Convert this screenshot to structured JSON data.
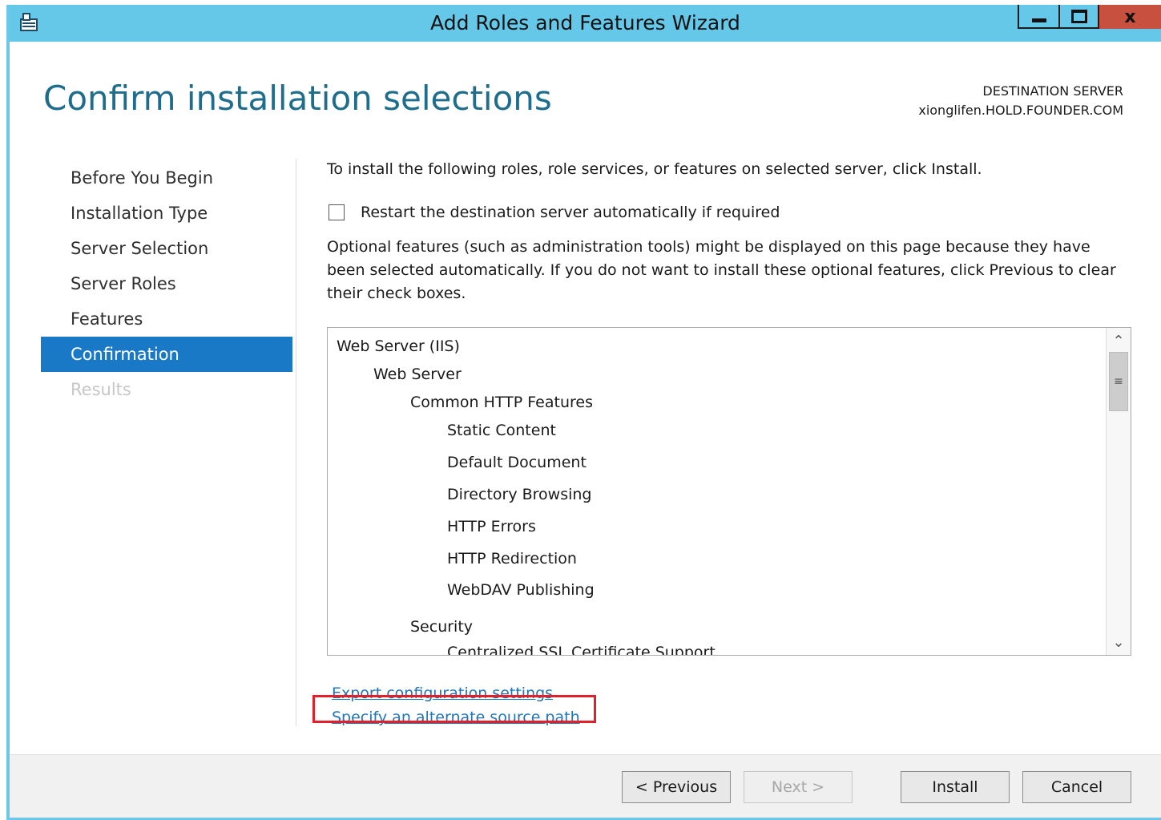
{
  "window": {
    "title": "Add Roles and Features Wizard"
  },
  "header": {
    "page_title": "Confirm installation selections",
    "destination_label": "DESTINATION SERVER",
    "destination_server": "xionglifen.HOLD.FOUNDER.COM"
  },
  "nav": {
    "items": [
      {
        "label": "Before You Begin",
        "state": "normal"
      },
      {
        "label": "Installation Type",
        "state": "normal"
      },
      {
        "label": "Server Selection",
        "state": "normal"
      },
      {
        "label": "Server Roles",
        "state": "normal"
      },
      {
        "label": "Features",
        "state": "normal"
      },
      {
        "label": "Confirmation",
        "state": "active"
      },
      {
        "label": "Results",
        "state": "disabled"
      }
    ]
  },
  "content": {
    "intro": "To install the following roles, role services, or features on selected server, click Install.",
    "restart_label": "Restart the destination server automatically if required",
    "restart_checked": false,
    "optional_note": "Optional features (such as administration tools) might be displayed on this page because they have been selected automatically. If you do not want to install these optional features, click Previous to clear their check boxes.",
    "selections": [
      {
        "label": "Web Server (IIS)",
        "level": 0
      },
      {
        "label": "Web Server",
        "level": 1
      },
      {
        "label": "Common HTTP Features",
        "level": 2
      },
      {
        "label": "Static Content",
        "level": 3
      },
      {
        "label": "Default Document",
        "level": 3
      },
      {
        "label": "Directory Browsing",
        "level": 3
      },
      {
        "label": "HTTP Errors",
        "level": 3
      },
      {
        "label": "HTTP Redirection",
        "level": 3
      },
      {
        "label": "WebDAV Publishing",
        "level": 3
      },
      {
        "label": "Security",
        "level": 2
      },
      {
        "label": "Centralized SSL Certificate Support",
        "level": 3
      }
    ],
    "export_link": "Export configuration settings",
    "alternate_link": "Specify an alternate source path"
  },
  "footer": {
    "previous": "< Previous",
    "next": "Next >",
    "install": "Install",
    "cancel": "Cancel"
  },
  "colors": {
    "titlebar": "#66c8e8",
    "accent": "#1979c6",
    "link": "#2175b9",
    "highlight": "#e2202b",
    "close_button": "#c7503e"
  }
}
